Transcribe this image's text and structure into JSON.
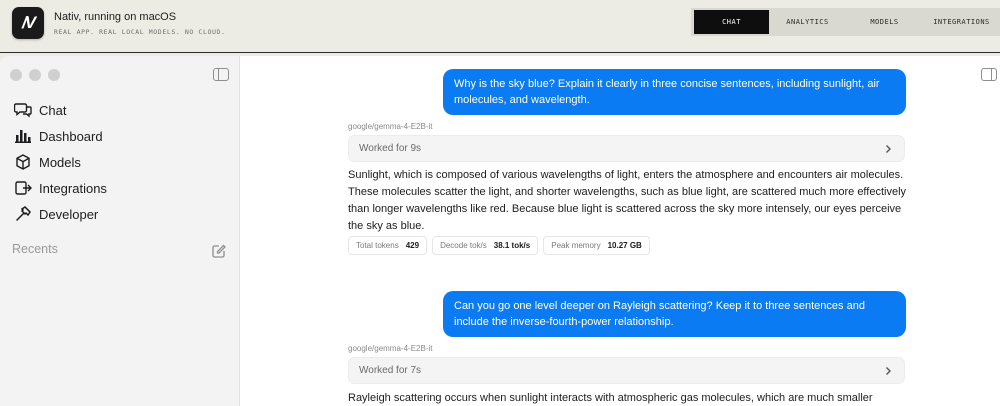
{
  "app": {
    "logo_text": "/V",
    "title": "Nativ, running on macOS",
    "subtitle": "REAL APP. REAL LOCAL MODELS. NO CLOUD."
  },
  "nav_tabs": [
    {
      "label": "CHAT",
      "active": true
    },
    {
      "label": "ANALYTICS",
      "active": false
    },
    {
      "label": "MODELS",
      "active": false
    },
    {
      "label": "INTEGRATIONS",
      "active": false
    }
  ],
  "sidebar": {
    "items": [
      {
        "label": "Chat",
        "icon": "chat-bubbles-icon"
      },
      {
        "label": "Dashboard",
        "icon": "bar-chart-icon"
      },
      {
        "label": "Models",
        "icon": "cube-icon"
      },
      {
        "label": "Integrations",
        "icon": "plug-icon"
      },
      {
        "label": "Developer",
        "icon": "hammer-icon"
      }
    ],
    "recents_label": "Recents"
  },
  "conversation": [
    {
      "user": "Why is the sky blue? Explain it clearly in three concise sentences, including sunlight, air molecules, and wavelength.",
      "model": "google/gemma-4-E2B-it",
      "worked": "Worked for 9s",
      "answer": "Sunlight, which is composed of various wavelengths of light, enters the atmosphere and encounters air molecules. These molecules scatter the light, and shorter wavelengths, such as blue light, are scattered much more effectively than longer wavelengths like red. Because blue light is scattered across the sky more intensely, our eyes perceive the sky as blue.",
      "stats": [
        {
          "label": "Total tokens",
          "value": "429"
        },
        {
          "label": "Decode tok/s",
          "value": "38.1 tok/s"
        },
        {
          "label": "Peak memory",
          "value": "10.27 GB"
        }
      ]
    },
    {
      "user": "Can you go one level deeper on Rayleigh scattering? Keep it to three sentences and include the inverse-fourth-power relationship.",
      "model": "google/gemma-4-E2B-it",
      "worked": "Worked for 7s",
      "answer": "Rayleigh scattering occurs when sunlight interacts with atmospheric gas molecules, which are much smaller"
    }
  ],
  "colors": {
    "accent": "#0a7bf2",
    "topbar_bg": "#ecebe4",
    "active_tab": "#0e0e0e"
  }
}
